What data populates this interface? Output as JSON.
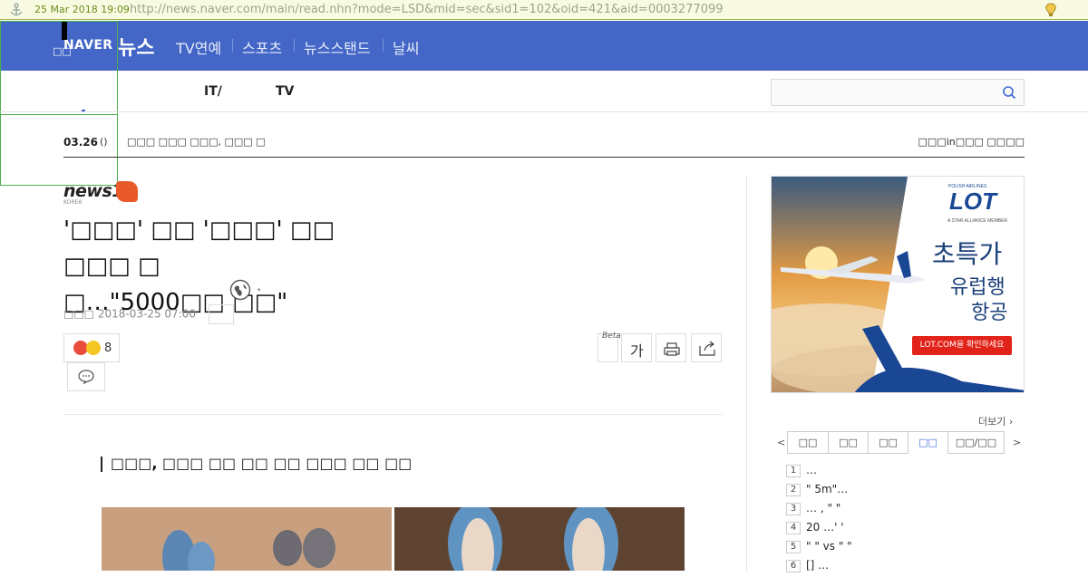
{
  "archive_bar": {
    "date": "25 Mar 2018 19:09",
    "url": "http://news.naver.com/main/read.nhn?mode=LSD&mid=sec&sid1=102&oid=421&aid=0003277099"
  },
  "header": {
    "logo": "NAVER",
    "news": "뉴스",
    "nav": [
      "TV연예",
      "스포츠",
      "뉴스스탠드",
      "날씨"
    ],
    "overlay_line1": "□□",
    "overlay_line2": "□□"
  },
  "sub_nav": {
    "items": [
      "IT/",
      "TV"
    ],
    "search_placeholder": ""
  },
  "ticker": {
    "date": "03.26",
    "day": "()",
    "headline": "□□□ □□□ □□□, □□□ □",
    "right": "□□□in□□□ □□□□"
  },
  "article": {
    "press": "news1",
    "press_sub": "KOREA",
    "title_line1": "'□□□' □□ '□□□' □□ □□□ □",
    "title_line2": "□…\"5000□□ □□\"",
    "byline_name": "□□□",
    "byline_date": "2018-03-25 07:00",
    "reaction_count": "8",
    "beta": "Beta",
    "font_button": "가",
    "subhead": "□□□, □□□ □□ □□ □□ □□□ □□ □□"
  },
  "ad": {
    "brand": "LOT",
    "brand_sub": "POLISH AIRLINES",
    "alliance": "A STAR ALLIANCE MEMBER",
    "headline": "초특가",
    "line2": "유럽행",
    "line3": "항공",
    "cta": "LOT.COM을 확인하세요"
  },
  "sidebar": {
    "more": "더보기",
    "tabs": [
      "□□",
      "□□",
      "□□",
      "□□",
      "□□/□□"
    ],
    "active_tab": 3,
    "ranks": [
      {
        "num": "1",
        "text": "…"
      },
      {
        "num": "2",
        "text": "\" 5m\"…"
      },
      {
        "num": "3",
        "text": "… , \" \""
      },
      {
        "num": "4",
        "text": "20  …' '"
      },
      {
        "num": "5",
        "text": "\" \" vs \" \""
      },
      {
        "num": "6",
        "text": "[]  …"
      }
    ]
  },
  "colors": {
    "header_blue": "#4366c7",
    "archive_green": "#6c8c1c",
    "ad_red": "#e2231a",
    "lot_blue": "#163d8a"
  }
}
